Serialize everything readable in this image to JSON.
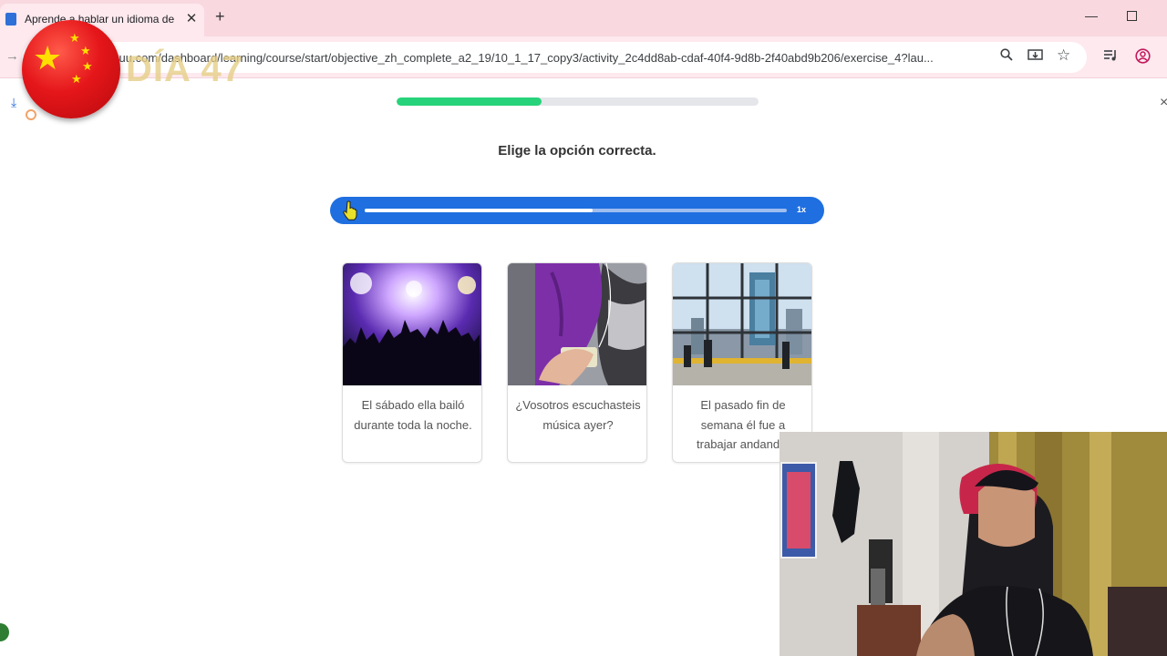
{
  "browser": {
    "tab_title": "Aprende a hablar un idioma de",
    "tab_close": "✕",
    "new_tab": "+",
    "url": "suu.com/dashboard/learning/course/start/objective_zh_complete_a2_19/10_1_17_copy3/activity_2c4dd8ab-cdaf-40f4-9d8b-2f40abd9b206/exercise_4?lau..."
  },
  "overlay": {
    "day_label": "DÍA 47",
    "flag_icon": "china-flag-icon"
  },
  "exercise": {
    "progress_fraction": 0.4,
    "instruction": "Elige la opción correcta.",
    "audio": {
      "progress_fraction": 0.54,
      "speed": "1x"
    },
    "options": [
      {
        "image_icon": "concert-crowd-image",
        "text": "El sábado ella bailó durante toda la noche."
      },
      {
        "image_icon": "phone-music-earphones-image",
        "text": "¿Vosotros escuchasteis música ayer?"
      },
      {
        "image_icon": "office-window-city-image",
        "text": "El pasado fin de semana él fue a trabajar andando."
      }
    ]
  },
  "colors": {
    "accent_blue": "#1f6fe0",
    "progress_green": "#27d37a",
    "tabbar_pink": "#f9d8e0"
  }
}
